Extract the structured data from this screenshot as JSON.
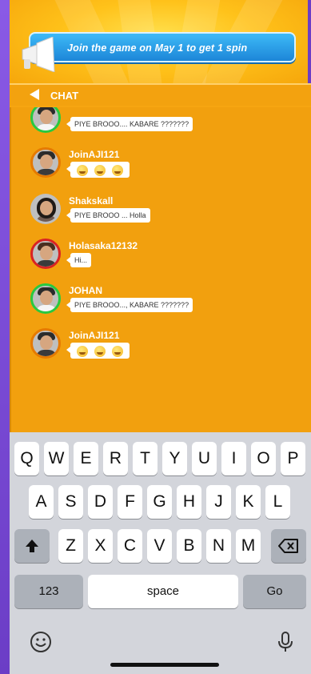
{
  "banner": {
    "text": "Join the game on May 1 to get 1 spin"
  },
  "chat": {
    "title": "CHAT",
    "messages": [
      {
        "name": "",
        "text": "PIYE BROOO.... KABARE ???????",
        "type": "text",
        "avatar_border": "#28c940"
      },
      {
        "name": "JoinAJI121",
        "text": "",
        "type": "emoji",
        "avatar_border": "#e57a00"
      },
      {
        "name": "Shakskall",
        "text": "PIYE BROOO ... Holla",
        "type": "text",
        "avatar_border": "#d92323"
      },
      {
        "name": "Holasaka12132",
        "text": "Hi...",
        "type": "text",
        "avatar_border": "#d92323"
      },
      {
        "name": "JOHAN",
        "text": "PIYE BROOO..., KABARE ???????",
        "type": "text",
        "avatar_border": "#28c940"
      },
      {
        "name": "JoinAJI121",
        "text": "",
        "type": "emoji",
        "avatar_border": "#e57a00"
      }
    ]
  },
  "keyboard": {
    "row1": [
      "Q",
      "W",
      "E",
      "R",
      "T",
      "Y",
      "U",
      "I",
      "O",
      "P"
    ],
    "row2": [
      "A",
      "S",
      "D",
      "F",
      "G",
      "H",
      "J",
      "K",
      "L"
    ],
    "row3": [
      "Z",
      "X",
      "C",
      "V",
      "B",
      "N",
      "M"
    ],
    "numbers_label": "123",
    "space_label": "space",
    "go_label": "Go"
  },
  "icons": {
    "back": "back-arrow-icon",
    "megaphone": "megaphone-icon",
    "shift": "shift-icon",
    "backspace": "backspace-icon",
    "emoji": "emoji-icon",
    "mic": "microphone-icon"
  },
  "colors": {
    "chat_bg": "#f2a00e",
    "banner": "#2a9de8",
    "keyboard_bg": "#d3d5db"
  }
}
